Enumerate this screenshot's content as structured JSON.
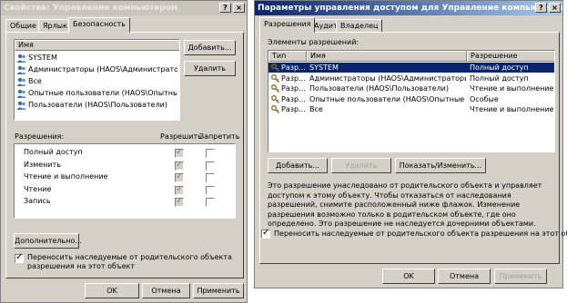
{
  "left_window": {
    "title": "Свойства: Управление компьютером",
    "tabs": [
      "Общие",
      "Ярлык",
      "Безопасность"
    ],
    "names_header": "Имя",
    "users": [
      "SYSTEM",
      "Администраторы (HAOS\\Администраторы)",
      "Все",
      "Опытные пользователи (HAOS\\Опытные ...",
      "Пользователи (HAOS\\Пользователи)"
    ],
    "add_button": "Добавить...",
    "remove_button": "Удалить",
    "perm_label": "Разрешения:",
    "allow_label": "Разрешить",
    "deny_label": "Запретить",
    "permissions": [
      "Полный доступ",
      "Изменить",
      "Чтение и выполнение",
      "Чтение",
      "Запись"
    ],
    "allow_checked": [
      true,
      true,
      true,
      true,
      true
    ],
    "deny_checked": [
      false,
      false,
      false,
      false,
      false
    ],
    "advanced_button": "Дополнительно...",
    "inherit_checkbox": "Переносить наследуемые от родительского объекта разрешения на этот объект",
    "inherit_checked": true,
    "ok": "OK",
    "cancel": "Отмена",
    "apply": "Применить"
  },
  "right_window": {
    "title": "Параметры управления доступом для Управление компьютером",
    "tabs": [
      "Разрешения",
      "Аудит",
      "Владелец"
    ],
    "elements_label": "Элементы разрешений:",
    "columns": [
      "Тип",
      "Имя",
      "Разрешение"
    ],
    "entries": [
      {
        "type": "Разр...",
        "name": "SYSTEM",
        "perm": "Полный доступ",
        "selected": true
      },
      {
        "type": "Разр...",
        "name": "Администраторы (HAOS\\Администраторы)",
        "perm": "Полный доступ",
        "selected": false
      },
      {
        "type": "Разр...",
        "name": "Пользователи (HAOS\\Пользователи)",
        "perm": "Чтение и выполнение",
        "selected": false
      },
      {
        "type": "Разр...",
        "name": "Опытные пользователи (HAOS\\Опытные пользо...",
        "perm": "Особые",
        "selected": false
      },
      {
        "type": "Разр...",
        "name": "Все",
        "perm": "Чтение и выполнение",
        "selected": false
      }
    ],
    "add_button": "Добавить...",
    "remove_button": "Удалить",
    "view_button": "Показать/Изменить...",
    "info_text": "Это разрешение унаследовано от родительского объекта и управляет доступом к этому объекту. Чтобы отказаться от наследования разрешений, снимите расположенный ниже флажок. Изменение разрешения возможно только в родительском объекте, где оно определено. Это разрешение не наследуется дочерними объектами.",
    "inherit_checkbox": "Переносить наследуемые от родительского объекта разрешения на этот объект",
    "inherit_checked": true,
    "ok": "OK",
    "cancel": "Отмена",
    "apply": "Применить"
  },
  "colors": {
    "active_title": "#0a246a",
    "selection": "#0a246a",
    "face": "#d4d0c8"
  }
}
